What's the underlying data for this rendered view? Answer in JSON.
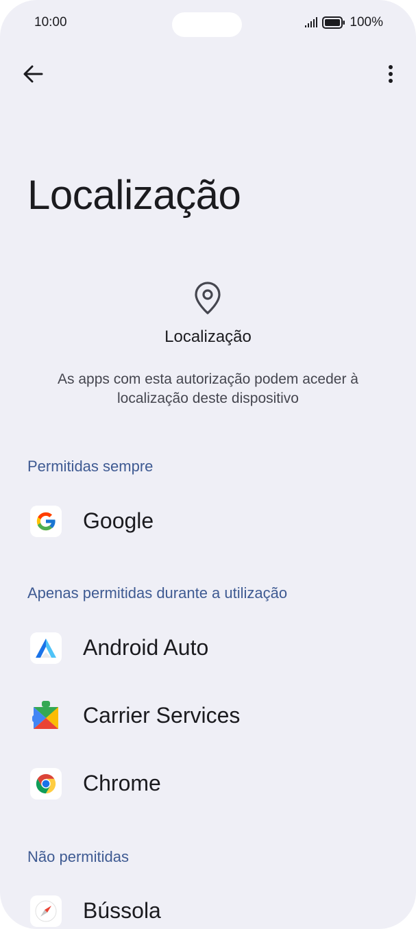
{
  "status_bar": {
    "time": "10:00",
    "battery": "100%"
  },
  "toolbar": {
    "back_icon": "arrow-left-icon",
    "more_icon": "more-vert-icon"
  },
  "page": {
    "title": "Localização"
  },
  "permission_header": {
    "icon": "location-pin-icon",
    "label": "Localização",
    "description": "As apps com esta autorização podem aceder à localização deste dispositivo"
  },
  "sections": [
    {
      "title": "Permitidas sempre",
      "apps": [
        {
          "name": "Google",
          "icon": "google-icon"
        }
      ]
    },
    {
      "title": "Apenas permitidas durante a utilização",
      "apps": [
        {
          "name": "Android Auto",
          "icon": "android-auto-icon"
        },
        {
          "name": "Carrier Services",
          "icon": "carrier-services-icon"
        },
        {
          "name": "Chrome",
          "icon": "chrome-icon"
        }
      ]
    },
    {
      "title": "Não permitidas",
      "apps": [
        {
          "name": "Bússola",
          "icon": "compass-icon"
        }
      ]
    }
  ],
  "colors": {
    "background": "#efeff6",
    "section_header": "#3e5a92",
    "text_primary": "#1b1b1f",
    "text_secondary": "#45464f"
  }
}
